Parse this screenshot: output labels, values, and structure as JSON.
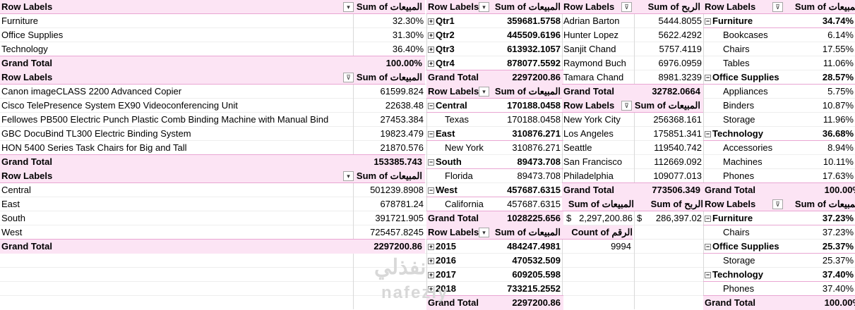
{
  "labels": {
    "row_labels": "Row Labels",
    "sum_sales": "Sum of المبيعات",
    "sum_profit": "Sum of الربح",
    "count_num": "Count of الرقم",
    "grand_total": "Grand Total"
  },
  "icons": {
    "dropdown": "chevron-down-icon",
    "filter": "filter-icon",
    "expand": "plus-box-icon",
    "collapse": "minus-box-icon"
  },
  "colors": {
    "header_bg": "#fce4f4",
    "header_border": "#e9a6d3"
  },
  "p1": {
    "rows": [
      {
        "label": "Furniture",
        "value": "32.30%"
      },
      {
        "label": "Office Supplies",
        "value": "31.30%"
      },
      {
        "label": "Technology",
        "value": "36.40%"
      }
    ],
    "total": "100.00%"
  },
  "p2": {
    "rows": [
      {
        "label": "Canon imageCLASS 2200 Advanced Copier",
        "value": "61599.824"
      },
      {
        "label": "Cisco TelePresence System EX90 Videoconferencing Unit",
        "value": "22638.48"
      },
      {
        "label": "Fellowes PB500 Electric Punch Plastic Comb Binding Machine with Manual Bind",
        "value": "27453.384"
      },
      {
        "label": "GBC DocuBind TL300 Electric Binding System",
        "value": "19823.479"
      },
      {
        "label": "HON 5400 Series Task Chairs for Big and Tall",
        "value": "21870.576"
      }
    ],
    "total": "153385.743"
  },
  "p3": {
    "rows": [
      {
        "label": "Central",
        "value": "501239.8908"
      },
      {
        "label": "East",
        "value": "678781.24"
      },
      {
        "label": "South",
        "value": "391721.905"
      },
      {
        "label": "West",
        "value": "725457.8245"
      }
    ],
    "total": "2297200.86"
  },
  "p4": {
    "rows": [
      {
        "label": "Qtr1",
        "value": "359681.5758"
      },
      {
        "label": "Qtr2",
        "value": "445509.6196"
      },
      {
        "label": "Qtr3",
        "value": "613932.1057"
      },
      {
        "label": "Qtr4",
        "value": "878077.5592"
      }
    ],
    "total": "2297200.86"
  },
  "p5": {
    "rows": [
      {
        "label": "Central",
        "value": "170188.0458",
        "sub": "Texas",
        "subval": "170188.0458"
      },
      {
        "label": "East",
        "value": "310876.271",
        "sub": "New York",
        "subval": "310876.271"
      },
      {
        "label": "South",
        "value": "89473.708",
        "sub": "Florida",
        "subval": "89473.708"
      },
      {
        "label": "West",
        "value": "457687.6315",
        "sub": "California",
        "subval": "457687.6315"
      }
    ],
    "total": "1028225.656"
  },
  "p6": {
    "rows": [
      {
        "label": "2015",
        "value": "484247.4981"
      },
      {
        "label": "2016",
        "value": "470532.509"
      },
      {
        "label": "2017",
        "value": "609205.598"
      },
      {
        "label": "2018",
        "value": "733215.2552"
      }
    ],
    "total": "2297200.86"
  },
  "p7": {
    "rows": [
      {
        "label": "Adrian Barton",
        "value": "5444.8055"
      },
      {
        "label": "Hunter Lopez",
        "value": "5622.4292"
      },
      {
        "label": "Sanjit Chand",
        "value": "5757.4119"
      },
      {
        "label": "Raymond Buch",
        "value": "6976.0959"
      },
      {
        "label": "Tamara Chand",
        "value": "8981.3239"
      }
    ],
    "total": "32782.0664"
  },
  "p8": {
    "rows": [
      {
        "label": "New York City",
        "value": "256368.161"
      },
      {
        "label": "Los Angeles",
        "value": "175851.341"
      },
      {
        "label": "Seattle",
        "value": "119540.742"
      },
      {
        "label": "San Francisco",
        "value": "112669.092"
      },
      {
        "label": "Philadelphia",
        "value": "109077.013"
      }
    ],
    "total": "773506.349"
  },
  "p9": {
    "cur": "$",
    "sales": "2,297,200.86",
    "profit": "286,397.02",
    "count": "9994"
  },
  "p10": {
    "groups": [
      {
        "label": "Furniture",
        "value": "34.74%",
        "items": [
          {
            "label": "Bookcases",
            "value": "6.14%"
          },
          {
            "label": "Chairs",
            "value": "17.55%"
          },
          {
            "label": "Tables",
            "value": "11.06%"
          }
        ]
      },
      {
        "label": "Office Supplies",
        "value": "28.57%",
        "items": [
          {
            "label": "Appliances",
            "value": "5.75%"
          },
          {
            "label": "Binders",
            "value": "10.87%"
          },
          {
            "label": "Storage",
            "value": "11.96%"
          }
        ]
      },
      {
        "label": "Technology",
        "value": "36.68%",
        "items": [
          {
            "label": "Accessories",
            "value": "8.94%"
          },
          {
            "label": "Machines",
            "value": "10.11%"
          },
          {
            "label": "Phones",
            "value": "17.63%"
          }
        ]
      }
    ],
    "total": "100.00%"
  },
  "p11": {
    "groups": [
      {
        "label": "Furniture",
        "value": "37.23%",
        "items": [
          {
            "label": "Chairs",
            "value": "37.23%"
          }
        ]
      },
      {
        "label": "Office Supplies",
        "value": "25.37%",
        "items": [
          {
            "label": "Storage",
            "value": "25.37%"
          }
        ]
      },
      {
        "label": "Technology",
        "value": "37.40%",
        "items": [
          {
            "label": "Phones",
            "value": "37.40%"
          }
        ]
      }
    ],
    "total": "100.00%"
  },
  "watermark": {
    "arabic": "نفذلي",
    "latin": "nafezly"
  }
}
